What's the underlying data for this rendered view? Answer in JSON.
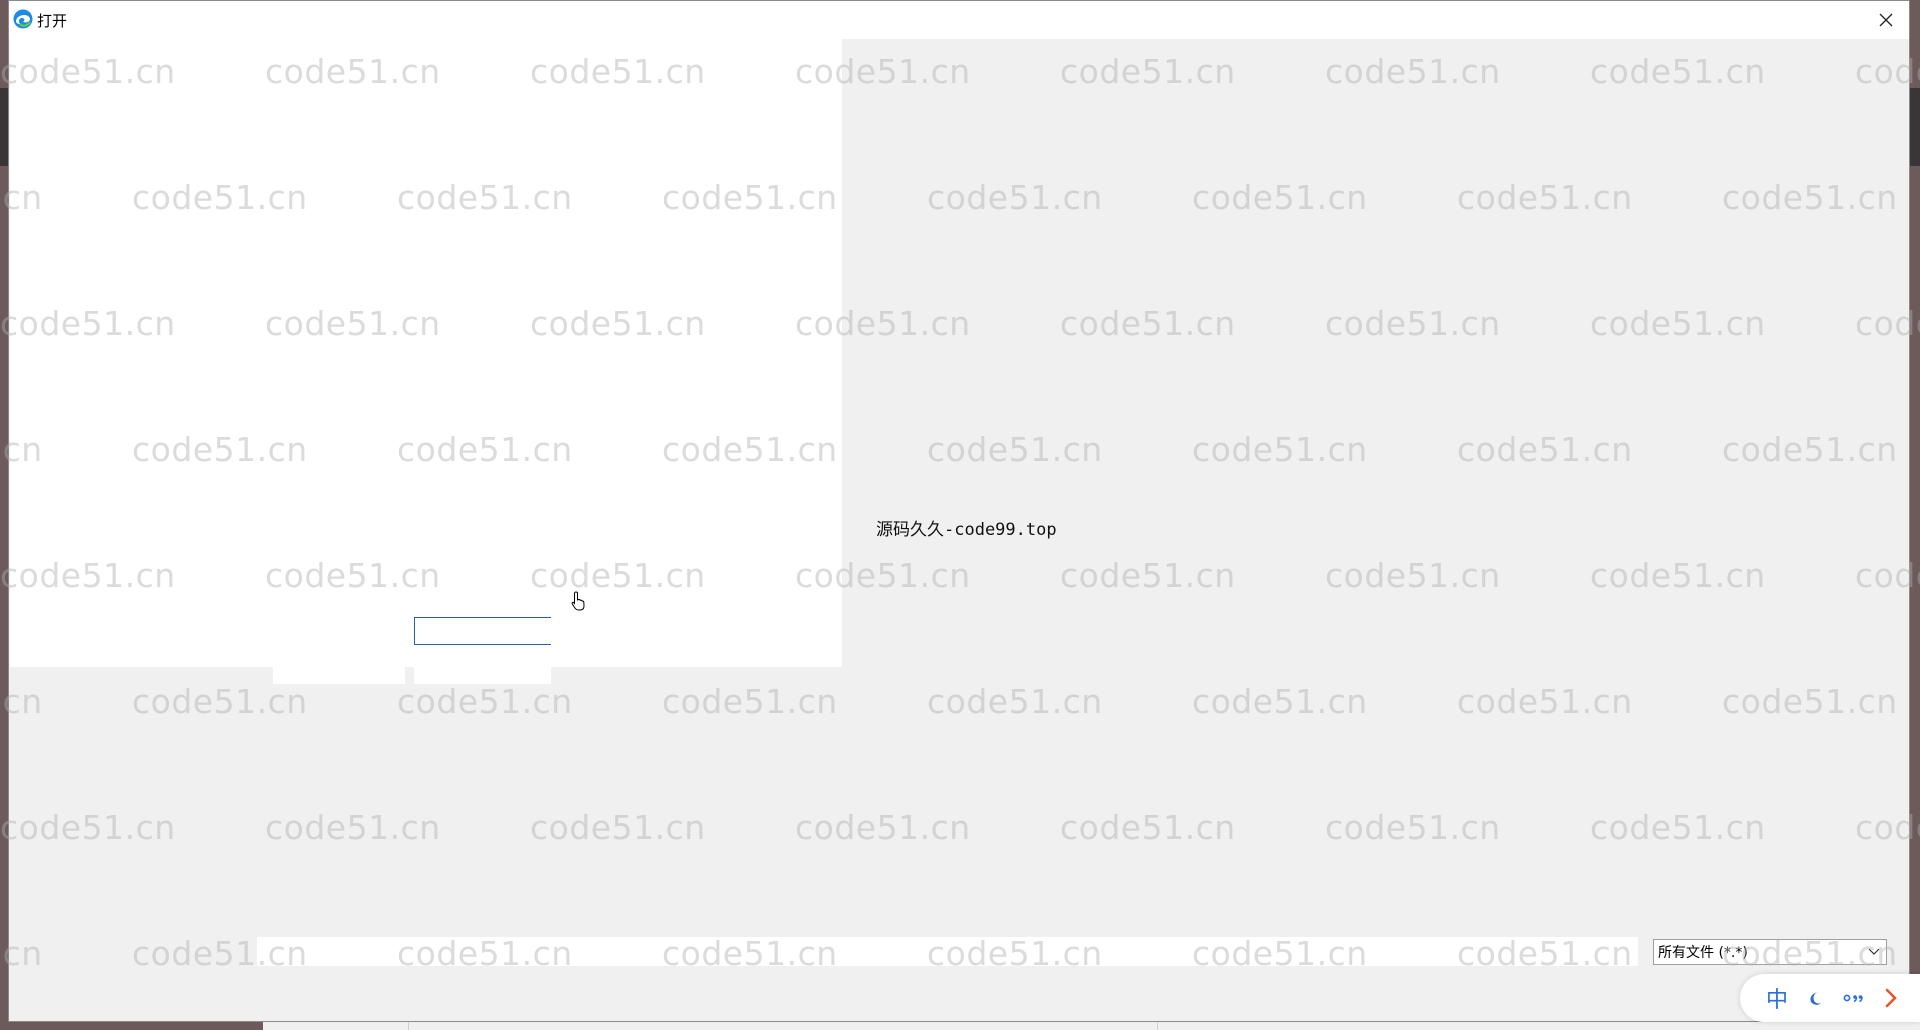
{
  "window": {
    "title": "打开",
    "close_icon": "close-icon",
    "app_icon": "edge-icon"
  },
  "main": {
    "center_text": "源码久久-code99.top",
    "file_name_value": ""
  },
  "file_type": {
    "selected": "所有文件 (*.*)"
  },
  "watermark": {
    "text": "code51.cn"
  },
  "ime": {
    "lang": "中",
    "icons": [
      "moon-icon",
      "punctuation-icon",
      "chevron-right-icon"
    ]
  },
  "colors": {
    "accent": "#2a6fd6",
    "input_border": "#2d5fa8",
    "arrow": "#e8552f"
  }
}
